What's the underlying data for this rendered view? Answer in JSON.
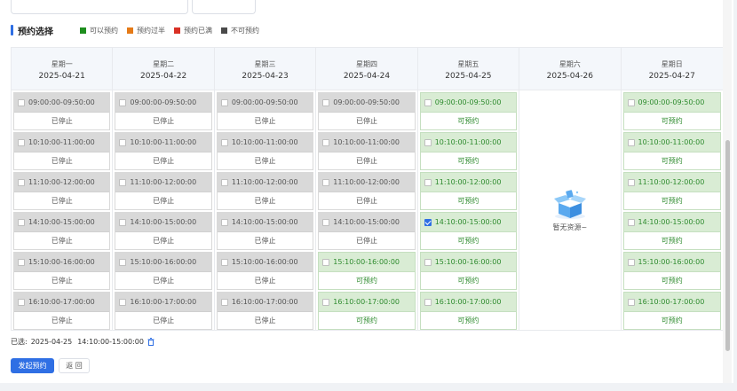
{
  "section": {
    "title": "预约选择"
  },
  "legend": [
    {
      "label": "可以预约",
      "color": "#1e8e1e"
    },
    {
      "label": "预约过半",
      "color": "#e57a17"
    },
    {
      "label": "预约已满",
      "color": "#d93025"
    },
    {
      "label": "不可预约",
      "color": "#4a4a4a"
    }
  ],
  "days": [
    {
      "weekday": "星期一",
      "date": "2025-04-21",
      "slots": [
        {
          "time": "09:00:00-09:50:00",
          "status": "已停止",
          "available": false,
          "checked": false
        },
        {
          "time": "10:10:00-11:00:00",
          "status": "已停止",
          "available": false,
          "checked": false
        },
        {
          "time": "11:10:00-12:00:00",
          "status": "已停止",
          "available": false,
          "checked": false
        },
        {
          "time": "14:10:00-15:00:00",
          "status": "已停止",
          "available": false,
          "checked": false
        },
        {
          "time": "15:10:00-16:00:00",
          "status": "已停止",
          "available": false,
          "checked": false
        },
        {
          "time": "16:10:00-17:00:00",
          "status": "已停止",
          "available": false,
          "checked": false
        }
      ]
    },
    {
      "weekday": "星期二",
      "date": "2025-04-22",
      "slots": [
        {
          "time": "09:00:00-09:50:00",
          "status": "已停止",
          "available": false,
          "checked": false
        },
        {
          "time": "10:10:00-11:00:00",
          "status": "已停止",
          "available": false,
          "checked": false
        },
        {
          "time": "11:10:00-12:00:00",
          "status": "已停止",
          "available": false,
          "checked": false
        },
        {
          "time": "14:10:00-15:00:00",
          "status": "已停止",
          "available": false,
          "checked": false
        },
        {
          "time": "15:10:00-16:00:00",
          "status": "已停止",
          "available": false,
          "checked": false
        },
        {
          "time": "16:10:00-17:00:00",
          "status": "已停止",
          "available": false,
          "checked": false
        }
      ]
    },
    {
      "weekday": "星期三",
      "date": "2025-04-23",
      "slots": [
        {
          "time": "09:00:00-09:50:00",
          "status": "已停止",
          "available": false,
          "checked": false
        },
        {
          "time": "10:10:00-11:00:00",
          "status": "已停止",
          "available": false,
          "checked": false
        },
        {
          "time": "11:10:00-12:00:00",
          "status": "已停止",
          "available": false,
          "checked": false
        },
        {
          "time": "14:10:00-15:00:00",
          "status": "已停止",
          "available": false,
          "checked": false
        },
        {
          "time": "15:10:00-16:00:00",
          "status": "已停止",
          "available": false,
          "checked": false
        },
        {
          "time": "16:10:00-17:00:00",
          "status": "已停止",
          "available": false,
          "checked": false
        }
      ]
    },
    {
      "weekday": "星期四",
      "date": "2025-04-24",
      "slots": [
        {
          "time": "09:00:00-09:50:00",
          "status": "已停止",
          "available": false,
          "checked": false
        },
        {
          "time": "10:10:00-11:00:00",
          "status": "已停止",
          "available": false,
          "checked": false
        },
        {
          "time": "11:10:00-12:00:00",
          "status": "已停止",
          "available": false,
          "checked": false
        },
        {
          "time": "14:10:00-15:00:00",
          "status": "已停止",
          "available": false,
          "checked": false
        },
        {
          "time": "15:10:00-16:00:00",
          "status": "可预约",
          "available": true,
          "checked": false
        },
        {
          "time": "16:10:00-17:00:00",
          "status": "可预约",
          "available": true,
          "checked": false
        }
      ]
    },
    {
      "weekday": "星期五",
      "date": "2025-04-25",
      "slots": [
        {
          "time": "09:00:00-09:50:00",
          "status": "可预约",
          "available": true,
          "checked": false
        },
        {
          "time": "10:10:00-11:00:00",
          "status": "可预约",
          "available": true,
          "checked": false
        },
        {
          "time": "11:10:00-12:00:00",
          "status": "可预约",
          "available": true,
          "checked": false
        },
        {
          "time": "14:10:00-15:00:00",
          "status": "可预约",
          "available": true,
          "checked": true
        },
        {
          "time": "15:10:00-16:00:00",
          "status": "可预约",
          "available": true,
          "checked": false
        },
        {
          "time": "16:10:00-17:00:00",
          "status": "可预约",
          "available": true,
          "checked": false
        }
      ]
    },
    {
      "weekday": "星期六",
      "date": "2025-04-26",
      "empty_text": "暂无资源~",
      "slots": []
    },
    {
      "weekday": "星期日",
      "date": "2025-04-27",
      "slots": [
        {
          "time": "09:00:00-09:50:00",
          "status": "可预约",
          "available": true,
          "checked": false
        },
        {
          "time": "10:10:00-11:00:00",
          "status": "可预约",
          "available": true,
          "checked": false
        },
        {
          "time": "11:10:00-12:00:00",
          "status": "可预约",
          "available": true,
          "checked": false
        },
        {
          "time": "14:10:00-15:00:00",
          "status": "可预约",
          "available": true,
          "checked": false
        },
        {
          "time": "15:10:00-16:00:00",
          "status": "可预约",
          "available": true,
          "checked": false
        },
        {
          "time": "16:10:00-17:00:00",
          "status": "可预约",
          "available": true,
          "checked": false
        }
      ]
    }
  ],
  "selection": {
    "label": "已选:",
    "date": "2025-04-25",
    "time": "14:10:00-15:00:00"
  },
  "actions": {
    "submit_label": "发起预约",
    "back_label": "返 回"
  }
}
